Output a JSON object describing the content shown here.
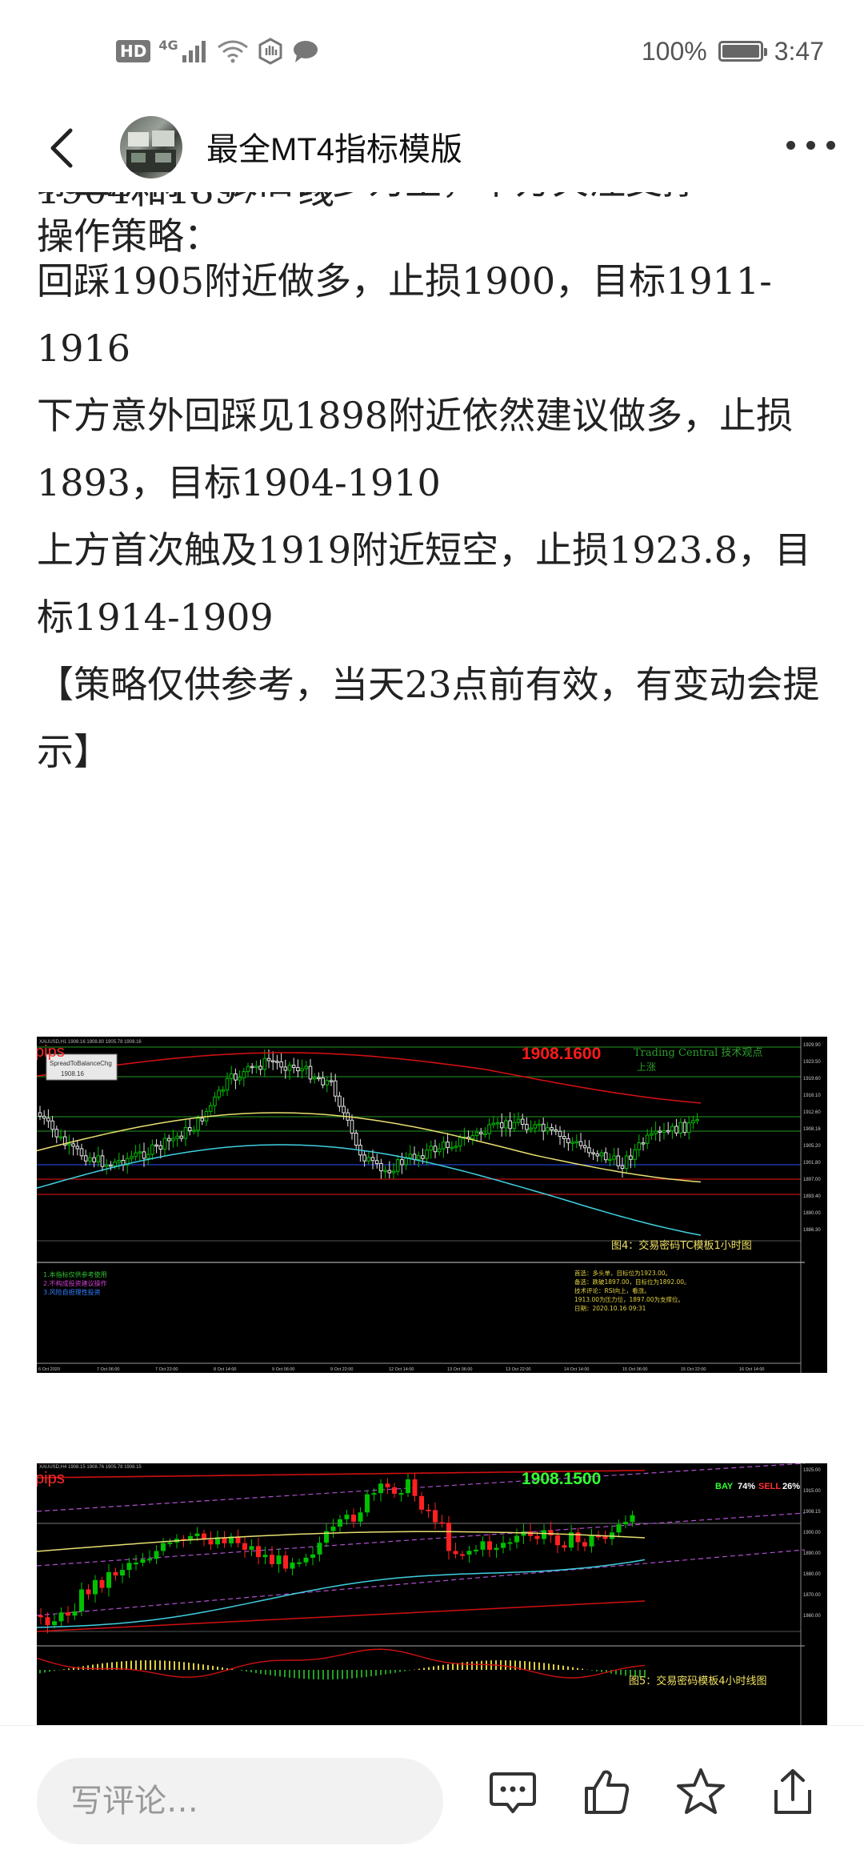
{
  "status_bar": {
    "network_badge": "HD",
    "signal_label": "4G",
    "battery_text": "100%",
    "time": "3:47",
    "battery_level": 1.0
  },
  "header": {
    "title": "最全MT4指标模版",
    "back_icon": "chevron-left-icon",
    "more_icon": "more-dots-icon"
  },
  "article": {
    "clipped_line": "综上所得：依旧做多为主，下方关注支撑",
    "paragraphs": [
      "1904和1897一线",
      "操作策略：",
      "回踩1905附近做多，止损1900，目标1911-1916",
      "下方意外回踩见1898附近依然建议做多，止损1893，目标1904-1910",
      "上方首次触及1919附近短空，止损1923.8，目标1914-1909",
      "【策略仅供参考，当天23点前有效，有变动会提示】"
    ]
  },
  "chart1": {
    "price_label": "1908.1600",
    "logo": "pips",
    "tc_label": "Trading Central 技术观点",
    "tc_sub": "上涨",
    "caption": "图4：交易密码TC模板1小时图",
    "tooltip_line1": "SpreadToBalanceChg",
    "tooltip_line2": "1908.16",
    "header_text": "XAUUSD,H1 1908.16 1908.80 1905.78 1908.16",
    "left_notes": [
      "1.本指标仅供参考使用",
      "2.不构成投资建议操作",
      "3.风险自担理性投资"
    ],
    "right_notes": [
      "首选：多头单，目标位为1923.00。",
      "备选：跌破1897.00，目标位为1892.00。",
      "技术评论：RSI向上，看涨。",
      "1913.00为压力位，1897.00为支撑位。",
      "日期：2020.10.16 09:31"
    ],
    "right_axis": [
      "1929.90",
      "1923.50",
      "1919.60",
      "1916.10",
      "1912.60",
      "1908.16",
      "1905.20",
      "1901.80",
      "1897.00",
      "1893.40",
      "1890.00",
      "1886.30"
    ],
    "bottom_axis": [
      "6 Oct 2020",
      "7 Oct 06:00",
      "7 Oct 22:00",
      "8 Oct 14:00",
      "9 Oct 06:00",
      "9 Oct 22:00",
      "12 Oct 14:00",
      "13 Oct 06:00",
      "13 Oct 22:00",
      "14 Oct 14:00",
      "15 Oct 06:00",
      "15 Oct 22:00",
      "16 Oct 14:00"
    ]
  },
  "chart2": {
    "price_label": "1908.1500",
    "logo": "pips",
    "buy_label": "BAY",
    "buy_pct": "74%",
    "sell_label": "SELL",
    "sell_pct": "26%",
    "caption": "图5：交易密码模板4小时线图",
    "header_text": "XAUUSD,H4 1908.15 1908.76 1905.78 1908.15",
    "right_axis": [
      "1925.00",
      "1915.00",
      "1908.15",
      "1900.00",
      "1890.00",
      "1880.00",
      "1870.00",
      "1860.00"
    ]
  },
  "bottom_bar": {
    "comment_placeholder": "写评论…",
    "icons": [
      "comment-icon",
      "like-icon",
      "star-icon",
      "share-icon"
    ]
  },
  "colors": {
    "chart_bg": "#000000",
    "bull_candle": "#00c000",
    "bear_candle": "#ff2020",
    "price_red": "#ff1a1a",
    "price_green": "#33ff33",
    "band_red": "#d01010",
    "ma_yellow": "#e8e070",
    "ma_cyan": "#40d0e0"
  }
}
